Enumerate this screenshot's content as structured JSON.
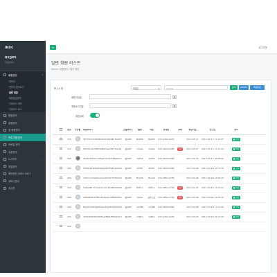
{
  "sidebar": {
    "logo": "INOC",
    "profile_name": "최고관리자",
    "profile_role": "지점선택 ▾",
    "group_head": "회원관리",
    "sub_items": [
      "관리자",
      "관리자 접속로그",
      "일반 회원",
      "회원등급관리",
      "디바이스 관리",
      "디바이스 로그"
    ],
    "items": [
      "협업관리",
      "설정관리",
      "앱 회원관리",
      "프로그램 관리",
      "모바일 관리",
      "쿠폰관리",
      "노사카드",
      "영업관리",
      "예약관리 서비스 2017",
      "세미나관리",
      "게시판"
    ]
  },
  "topbar": {
    "menu_icon": "≡",
    "logout": "로그아웃"
  },
  "page": {
    "title": "일반 회원 리스트",
    "breadcrumb": "Home  /  회원관리  /  일반 회원"
  },
  "filter": {
    "total_label": "총 2,9 명",
    "select1": "회원모",
    "search_placeholder": "Search",
    "search_btn": "검색",
    "reset_btn": "RESET",
    "excel_btn": "엑셀다운",
    "join_date_label": "회원가입일",
    "last_login_label": "최종로그인일",
    "status_label": "회원상태"
  },
  "table": {
    "headers": [
      "",
      "번호",
      "프로필",
      "회원아이디",
      "소셜서비스",
      "별명",
      "이름",
      "휴대폰",
      "상태",
      "회원가입",
      "로그인",
      "관리"
    ],
    "rows": [
      {
        "no": "316",
        "id": "3875707cb99c8b203162228d7fa257_M",
        "social": "웹/APP",
        "nick": "BetQ5i",
        "name": "BetQ5i",
        "phone": "010-3164-0254",
        "status": "",
        "joined": "2017-05-17",
        "login": "2017-05-17 17:13:25"
      },
      {
        "no": "315",
        "id": "9b5d5cdb1f6f5d48e55ae28271b518_M",
        "social": "웹/APP",
        "nick": "Orabe",
        "name": "Orabe",
        "phone": "010-3629-5385",
        "status": "중지",
        "joined": "2017-05-17",
        "login": "2017-05-17 17:11:23"
      },
      {
        "no": "306",
        "id": "4ba6740f7b7c05ae5701bd768ebb2196_M",
        "social": "웹/APP",
        "nick": "XsPL6",
        "name": "XsPL6",
        "phone": "010-3629-5385",
        "status": "",
        "joined": "2017-05-16",
        "login": "2017-05-17 16:08:29"
      },
      {
        "no": "305",
        "id": "53f9fa152fdb819bbe0af7f9424a504a_M",
        "social": "웹/APP",
        "nick": "ZHiFb",
        "name": "ZHiFb",
        "phone": "010-3629-5385",
        "status": "",
        "joined": "2017-04-26",
        "login": "2017-04-28 12:33:34"
      },
      {
        "no": "304",
        "id": "d33ccc7/4a2b5ce1c2f2237d7d5b0131_M",
        "social": "웹/APP",
        "nick": "BoxOS",
        "name": "BoxOS",
        "phone": "010-3851-2756",
        "status": "",
        "joined": "2017-04-26",
        "login": "2017-04-26 14:55:34"
      },
      {
        "no": "303",
        "id": "5a6a48d7713e1bdc1d11b3562220213_M",
        "social": "웹/APP",
        "nick": "EOficu",
        "name": "EOficu",
        "phone": "010-3851-2756",
        "status": "중지",
        "joined": "2017-02-21",
        "login": "2017-04-24 11:22:01"
      },
      {
        "no": "299",
        "id": "a5628d5b478f1b1e5e1ec3560550016_M",
        "social": "웹/APP",
        "nick": "test4",
        "name": "윤줄고조",
        "phone": "010-3851-2756",
        "status": "중지",
        "joined": "2017-03-28",
        "login": "2017-04-04 17:22:18"
      },
      {
        "no": "243",
        "id": "f8e1b7cb6c6a5f2ab15e1fb11b5b2b69_M",
        "social": "웹/APP",
        "nick": "n0nBfj",
        "name": "n0nBfj",
        "phone": "010-3629-5385",
        "status": "",
        "joined": "2017-03-28",
        "login": "2017-03-28 17:41:29"
      },
      {
        "no": "241",
        "id": "4031093b5bb6f4f1e2f8a67f65b0d1354c_M",
        "social": "웹/APP",
        "nick": "zuBCx",
        "name": "zuBCx",
        "phone": "010-3164-0254",
        "status": "",
        "joined": "2017-03-23",
        "login": "2017-03-23 15:12:43"
      },
      {
        "no": "240",
        "id": "",
        "social": "",
        "nick": "",
        "name": "",
        "phone": "",
        "status": "",
        "joined": "",
        "login": ""
      }
    ],
    "edit_label": "■ 수정"
  },
  "colors": {
    "accent": "#1aae78",
    "sidebar_bg": "#2d353c",
    "danger": "#e8504f"
  }
}
